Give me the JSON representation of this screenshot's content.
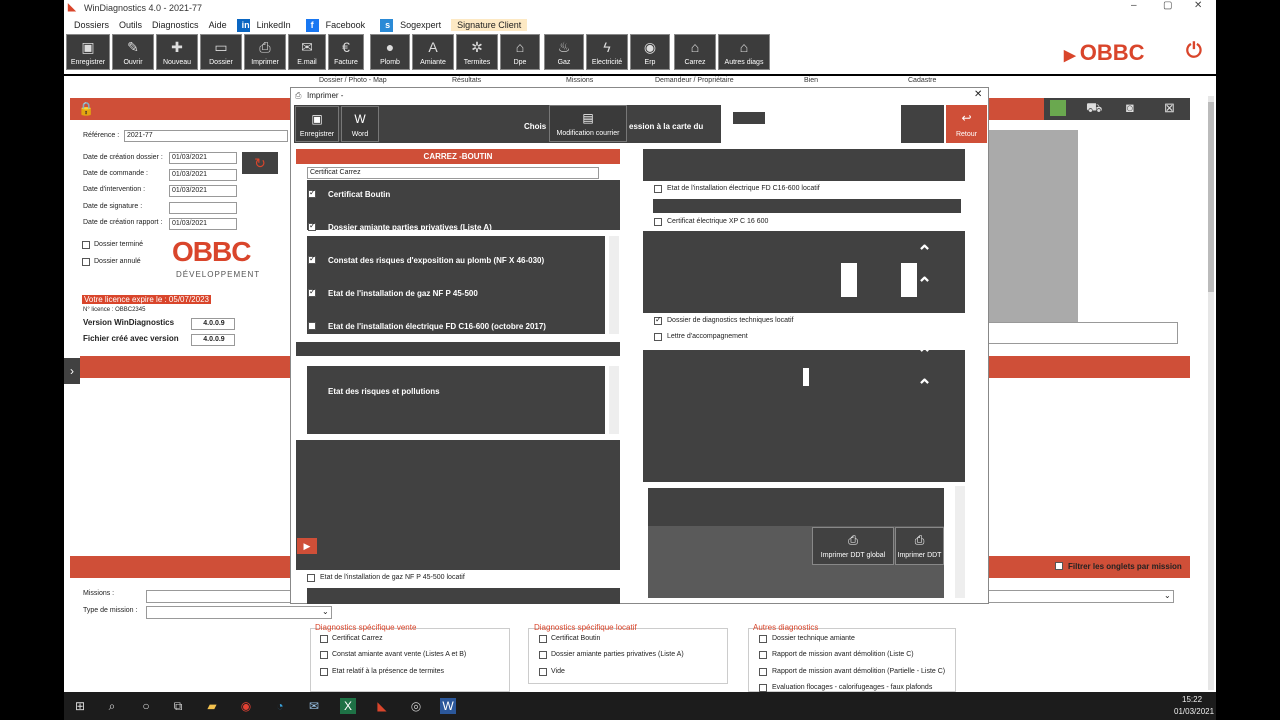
{
  "app": {
    "title": "WinDiagnostics 4.0 - 2021-77",
    "minimize": "–",
    "maximize": "▢",
    "close": "✕"
  },
  "menu": {
    "items": [
      "Dossiers",
      "Outils",
      "Diagnostics",
      "Aide"
    ],
    "linkedin": "LinkedIn",
    "facebook": "Facebook",
    "sogexpert": "Sogexpert",
    "signature": "Signature Client"
  },
  "toolbar": {
    "buttons": [
      "Enregistrer",
      "Ouvrir",
      "Nouveau",
      "Dossier",
      "Imprimer",
      "E.mail",
      "Facture",
      "Plomb",
      "Amiante",
      "Termites",
      "Dpe",
      "Gaz",
      "Electricité",
      "Erp",
      "Carrez",
      "Autres diags"
    ],
    "brand": "OBBC"
  },
  "sections": [
    "Dossier / Photo - Map",
    "Résultats",
    "Missions",
    "Demandeur / Propriétaire",
    "Bien",
    "Cadastre"
  ],
  "form": {
    "reference_label": "Référence :",
    "reference_value": "2021-77",
    "creation_label": "Date de création dossier :",
    "creation_value": "01/03/2021",
    "commande_label": "Date de commande :",
    "commande_value": "01/03/2021",
    "intervention_label": "Date d'intervention :",
    "intervention_value": "01/03/2021",
    "signature_label": "Date de signature :",
    "signature_value": "",
    "rapport_label": "Date de création rapport :",
    "rapport_value": "01/03/2021",
    "termine_label": "Dossier terminé",
    "annule_label": "Dossier annulé",
    "brand_big": "OBBC",
    "brand_sub": "DÉVELOPPEMENT",
    "licence_expire": "Votre licence expire le : 05/07/2023",
    "licence_no": "N° licence : OBBC2345",
    "version_label": "Version WinDiagnostics",
    "version_value": "4.0.0.9",
    "fichier_label": "Fichier créé avec version",
    "fichier_value": "4.0.0.9",
    "missions_label": "Missions :",
    "type_label": "Type de mission :",
    "filter_label": "Filtrer les onglets par mission"
  },
  "dialog": {
    "title": "Imprimer -",
    "close": "✕",
    "enregistrer": "Enregistrer",
    "word": "Word",
    "choose": "Chois",
    "modif": "Modification courrier",
    "impression": "ession à la carte du",
    "retour": "Retour",
    "header": "CARREZ -BOUTIN",
    "cert_input": "Certificat Carrez",
    "list1": [
      {
        "label": "Certificat Boutin",
        "checked": true
      },
      {
        "label": "Dossier amiante parties privatives (Liste A)",
        "checked": true
      }
    ],
    "list2": [
      {
        "label": "Constat des risques d'exposition au plomb (NF X 46-030)",
        "checked": true
      },
      {
        "label": "Etat de l'installation de gaz NF P 45-500",
        "checked": true
      },
      {
        "label": "Etat de l'installation électrique FD C16-600 (octobre 2017)",
        "checked": false
      }
    ],
    "list3": [
      {
        "label": "Etat des risques et pollutions",
        "checked": false
      }
    ],
    "gaz_locatif": "Etat de l'installation de gaz NF P 45-500 locatif",
    "right_items": [
      {
        "label": "Etat de l'installation électrique FD C16-600 locatif",
        "checked": false
      },
      {
        "label": "Certificat électrique XP C 16 600",
        "checked": false
      }
    ],
    "ddt_locatif": {
      "label": "Dossier de diagnostics techniques locatif",
      "checked": true
    },
    "lettre": {
      "label": "Lettre d'accompagnement",
      "checked": false
    },
    "print_global": "Imprimer DDT global",
    "print_ddt": "Imprimer DDT"
  },
  "missions_panel": {
    "vente_title": "Diagnostics spécifique vente",
    "vente": [
      "Certificat Carrez",
      "Constat amiante avant vente (Listes A et B)",
      "Etat relatif à la présence de termites"
    ],
    "locatif_title": "Diagnostics spécifique locatif",
    "locatif": [
      "Certificat Boutin",
      "Dossier amiante parties privatives (Liste A)",
      "Vide"
    ],
    "autres_title": "Autres diagnostics",
    "autres": [
      "Dossier technique amiante",
      "Rapport de mission avant démolition (Liste C)",
      "Rapport de mission avant démolition (Partielle - Liste C)",
      "Evaluation flocages - calorifugeages - faux plafonds"
    ]
  },
  "taskbar": {
    "time": "15:22",
    "date": "01/03/2021"
  },
  "colors": {
    "accent": "#cf4f38",
    "dark": "#414141"
  }
}
